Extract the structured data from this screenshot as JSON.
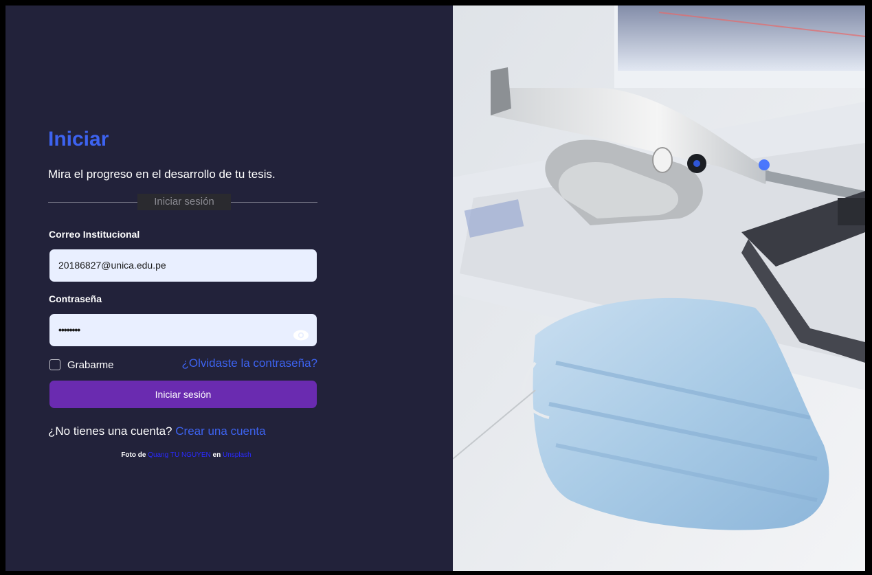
{
  "login": {
    "title": "Iniciar",
    "subtitle": "Mira el progreso en el desarrollo de tu tesis.",
    "divider_label": "Iniciar sesión",
    "email_label": "Correo Institucional",
    "email_value": "20186827@unica.edu.pe",
    "password_label": "Contraseña",
    "password_value": "••••••••",
    "remember_label": "Grabarme",
    "forgot_link": "¿Olvidaste la contraseña?",
    "submit_label": "Iniciar sesión",
    "no_account_text": "¿No tienes una cuenta?",
    "create_account_link": "Crear una cuenta",
    "photo_credit_prefix": "Foto de",
    "photo_credit_author": "Quang TU NGUYEN",
    "photo_credit_middle": "en",
    "photo_credit_source": "Unsplash"
  },
  "icons": {
    "password_toggle": "eye-icon",
    "remember": "checkbox"
  },
  "colors": {
    "left_panel_bg": "#22223a",
    "accent_blue": "#3d63f0",
    "button_purple": "#6a2bb0",
    "input_bg": "#e9efff"
  }
}
